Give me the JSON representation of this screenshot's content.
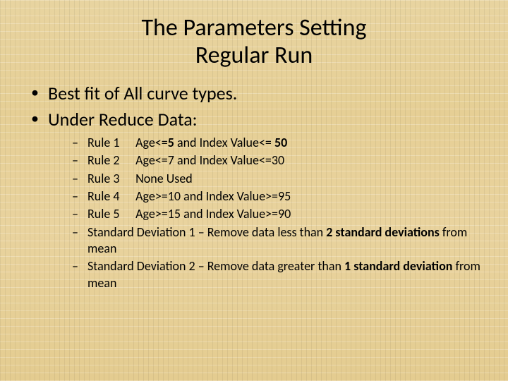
{
  "title_line1": "The Parameters Setting",
  "title_line2": "Regular Run",
  "bullets": {
    "b1": "Best fit of All curve types.",
    "b2": "Under Reduce Data:"
  },
  "rules": {
    "r1_label": "Rule 1",
    "r1_text_a": "Age<=",
    "r1_text_b": " and Index Value<= ",
    "r1_bold1": "5",
    "r1_bold2": "50",
    "r2_label": "Rule 2",
    "r2_text": "Age<=7 and Index Value<=30",
    "r3_label": "Rule 3",
    "r3_text": "None Used",
    "r4_label": "Rule 4",
    "r4_text": "Age>=10 and Index Value>=95",
    "r5_label": "Rule 5",
    "r5_text": "Age>=15 and Index Value>=90",
    "sd1_a": "Standard Deviation 1 – Remove data less than ",
    "sd1_bold": "2 standard deviations",
    "sd1_b": " from mean",
    "sd2_a": "Standard Deviation 2 – Remove data greater than ",
    "sd2_bold": "1 standard deviation",
    "sd2_b": " from mean"
  }
}
